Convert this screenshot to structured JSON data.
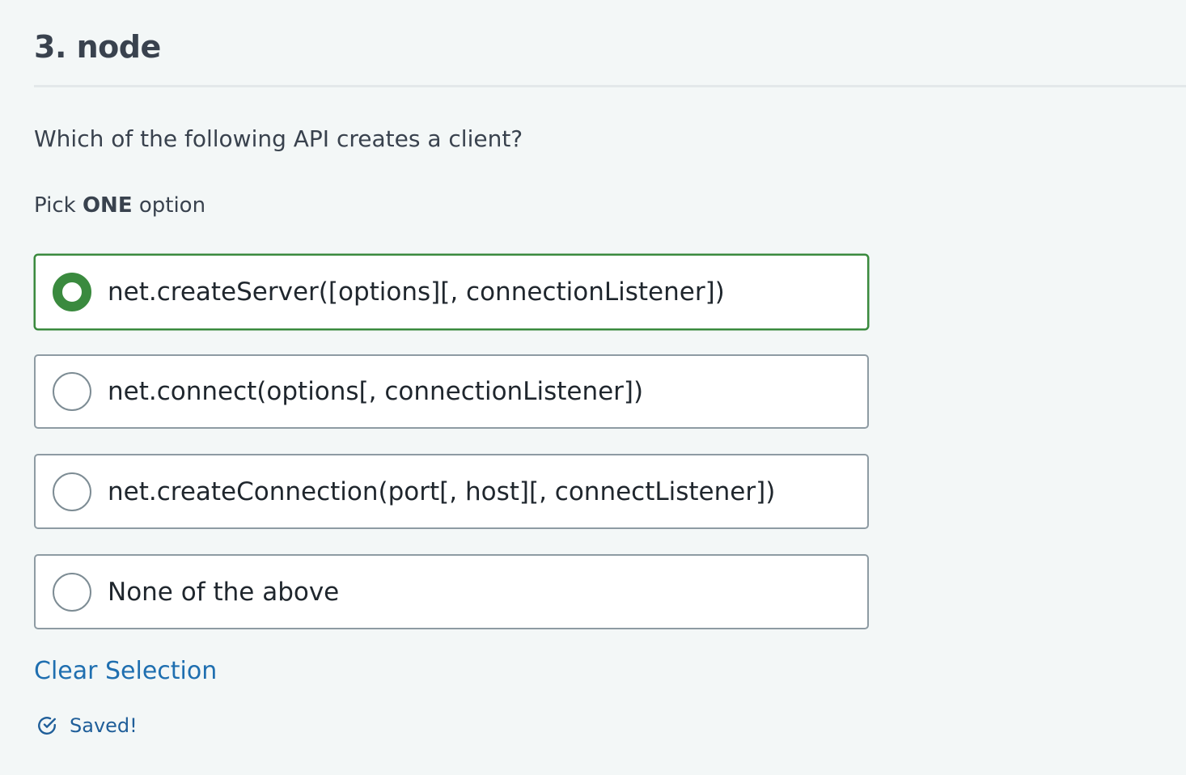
{
  "question": {
    "title": "3. node",
    "text": "Which of the following API creates a client?",
    "instruction_prefix": "Pick ",
    "instruction_emphasis": "ONE",
    "instruction_suffix": " option"
  },
  "options": [
    {
      "label": "net.createServer([options][, connectionListener])",
      "selected": true
    },
    {
      "label": "net.connect(options[, connectionListener])",
      "selected": false
    },
    {
      "label": "net.createConnection(port[, host][, connectListener])",
      "selected": false
    },
    {
      "label": "None of the above",
      "selected": false
    }
  ],
  "actions": {
    "clear_selection_label": "Clear Selection"
  },
  "status": {
    "saved_label": "Saved!",
    "icon": "check-circle-icon"
  },
  "colors": {
    "background": "#f3f7f7",
    "text": "#39424e",
    "selected_green": "#3a8a3e",
    "link_blue": "#1f6fb0",
    "saved_blue": "#1f5e99"
  }
}
